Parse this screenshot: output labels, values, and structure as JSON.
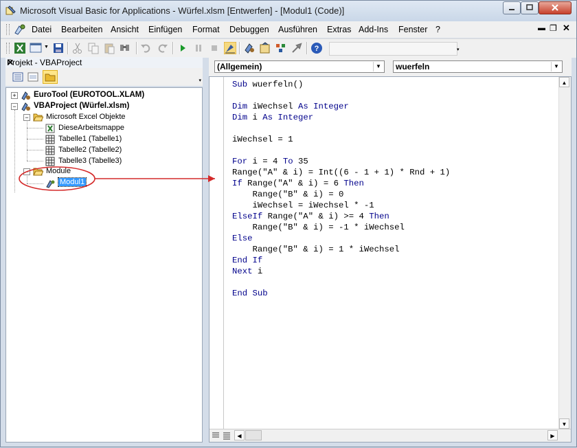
{
  "window": {
    "title": "Microsoft Visual Basic for Applications - Würfel.xlsm [Entwerfen] - [Modul1 (Code)]"
  },
  "menu": [
    "Datei",
    "Bearbeiten",
    "Ansicht",
    "Einfügen",
    "Format",
    "Debuggen",
    "Ausführen",
    "Extras",
    "Add-Ins",
    "Fenster",
    "?"
  ],
  "project": {
    "title": "Projekt - VBAProject",
    "close": "✕",
    "tree": {
      "eurotool": "EuroTool (EUROTOOL.XLAM)",
      "vbaproject": "VBAProject (Würfel.xlsm)",
      "excel_objects": "Microsoft Excel Objekte",
      "sheets": [
        "DieseArbeitsmappe",
        "Tabelle1 (Tabelle1)",
        "Tabelle2 (Tabelle2)",
        "Tabelle3 (Tabelle3)"
      ],
      "modules_folder": "Module",
      "module1": "Modul1"
    }
  },
  "code_window": {
    "object_combo": "(Allgemein)",
    "proc_combo": "wuerfeln",
    "lines": [
      [
        {
          "k": "Sub "
        },
        {
          "t": "wuerfeln()"
        }
      ],
      [],
      [
        {
          "k": "Dim "
        },
        {
          "t": "iWechsel "
        },
        {
          "k": "As Integer"
        }
      ],
      [
        {
          "k": "Dim "
        },
        {
          "t": "i "
        },
        {
          "k": "As Integer"
        }
      ],
      [],
      [
        {
          "t": "iWechsel = 1"
        }
      ],
      [],
      [
        {
          "k": "For "
        },
        {
          "t": "i = 4 "
        },
        {
          "k": "To "
        },
        {
          "t": "35"
        }
      ],
      [
        {
          "t": "Range(\"A\" & i) = Int((6 - 1 + 1) * Rnd + 1)"
        }
      ],
      [
        {
          "k": "If "
        },
        {
          "t": "Range(\"A\" & i) = 6 "
        },
        {
          "k": "Then"
        }
      ],
      [
        {
          "t": "    Range(\"B\" & i) = 0"
        }
      ],
      [
        {
          "t": "    iWechsel = iWechsel * -1"
        }
      ],
      [
        {
          "k": "ElseIf "
        },
        {
          "t": "Range(\"A\" & i) >= 4 "
        },
        {
          "k": "Then"
        }
      ],
      [
        {
          "t": "    Range(\"B\" & i) = -1 * iWechsel"
        }
      ],
      [
        {
          "k": "Else"
        }
      ],
      [
        {
          "t": "    Range(\"B\" & i) = 1 * iWechsel"
        }
      ],
      [
        {
          "k": "End If"
        }
      ],
      [
        {
          "k": "Next "
        },
        {
          "t": "i"
        }
      ],
      [],
      [
        {
          "k": "End Sub"
        }
      ]
    ]
  },
  "colors": {
    "keyword": "#00008b",
    "annotation": "#d42a2a",
    "selection": "#3399ff"
  }
}
